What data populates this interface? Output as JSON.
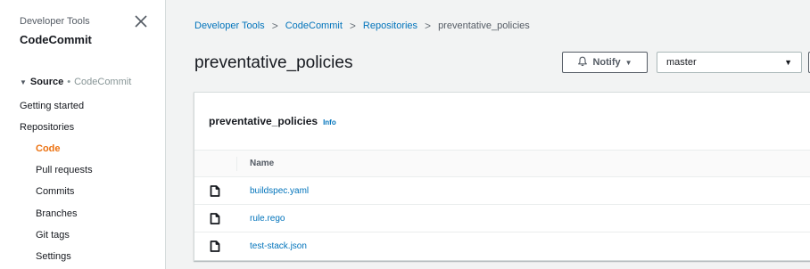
{
  "sidebar": {
    "section_label": "Developer Tools",
    "title": "CodeCommit",
    "close_icon": "close-icon",
    "group": {
      "label": "Source",
      "separator": "•",
      "service": "CodeCommit",
      "expand_icon": "caret-down-icon"
    },
    "items": {
      "getting_started": "Getting started",
      "repositories": "Repositories",
      "code": "Code",
      "pull_requests": "Pull requests",
      "commits": "Commits",
      "branches": "Branches",
      "git_tags": "Git tags",
      "settings": "Settings"
    },
    "active_item": "Code",
    "active_color": "#ec7211"
  },
  "breadcrumb": {
    "items": [
      "Developer Tools",
      "CodeCommit",
      "Repositories",
      "preventative_policies"
    ],
    "separator": ">"
  },
  "page": {
    "title": "preventative_policies"
  },
  "toolbar": {
    "notify_label": "Notify",
    "notify_icon": "bell-icon",
    "branch_value": "master"
  },
  "panel": {
    "title": "preventative_policies",
    "info_label": "Info",
    "column_name": "Name",
    "files": [
      {
        "name": "buildspec.yaml",
        "icon": "file-icon"
      },
      {
        "name": "rule.rego",
        "icon": "file-icon"
      },
      {
        "name": "test-stack.json",
        "icon": "file-icon"
      }
    ]
  },
  "colors": {
    "link": "#0073bb",
    "background": "#f2f3f3",
    "text": "#16191f"
  }
}
